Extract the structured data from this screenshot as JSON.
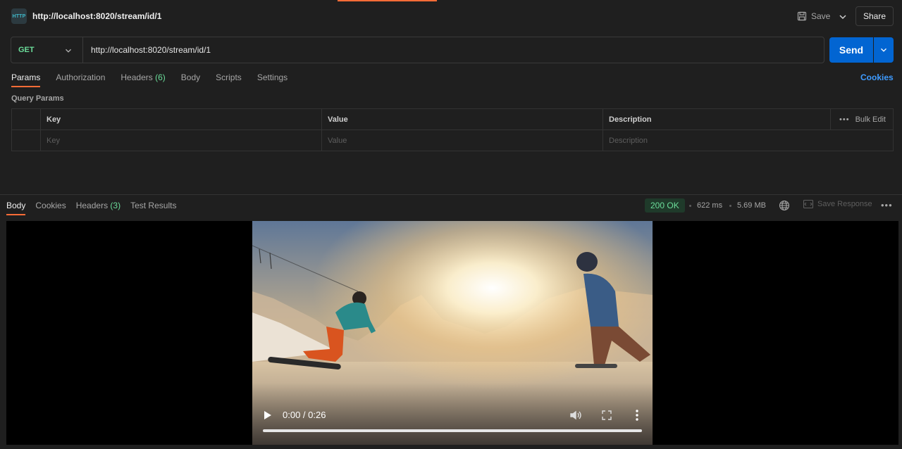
{
  "header": {
    "icon_label": "HTTP",
    "title": "http://localhost:8020/stream/id/1",
    "save_label": "Save",
    "share_label": "Share"
  },
  "request": {
    "method": "GET",
    "url": "http://localhost:8020/stream/id/1",
    "send_label": "Send"
  },
  "req_tabs": [
    {
      "label": "Params"
    },
    {
      "label": "Authorization"
    },
    {
      "label": "Headers",
      "count": "(6)"
    },
    {
      "label": "Body"
    },
    {
      "label": "Scripts"
    },
    {
      "label": "Settings"
    }
  ],
  "cookies_link": "Cookies",
  "query_params": {
    "label": "Query Params",
    "headers": [
      "Key",
      "Value",
      "Description"
    ],
    "bulk_edit": "Bulk Edit",
    "placeholders": [
      "Key",
      "Value",
      "Description"
    ]
  },
  "response": {
    "tabs": [
      {
        "label": "Body"
      },
      {
        "label": "Cookies"
      },
      {
        "label": "Headers",
        "count": "(3)"
      },
      {
        "label": "Test Results"
      }
    ],
    "status": "200 OK",
    "time": "622 ms",
    "size": "5.69 MB",
    "save_response": "Save Response"
  },
  "video": {
    "time": "0:00 / 0:26"
  },
  "colors": {
    "accent": "#ff6c37",
    "send": "#0265d2",
    "success": "#6bdd9a",
    "link": "#3e9bff"
  }
}
